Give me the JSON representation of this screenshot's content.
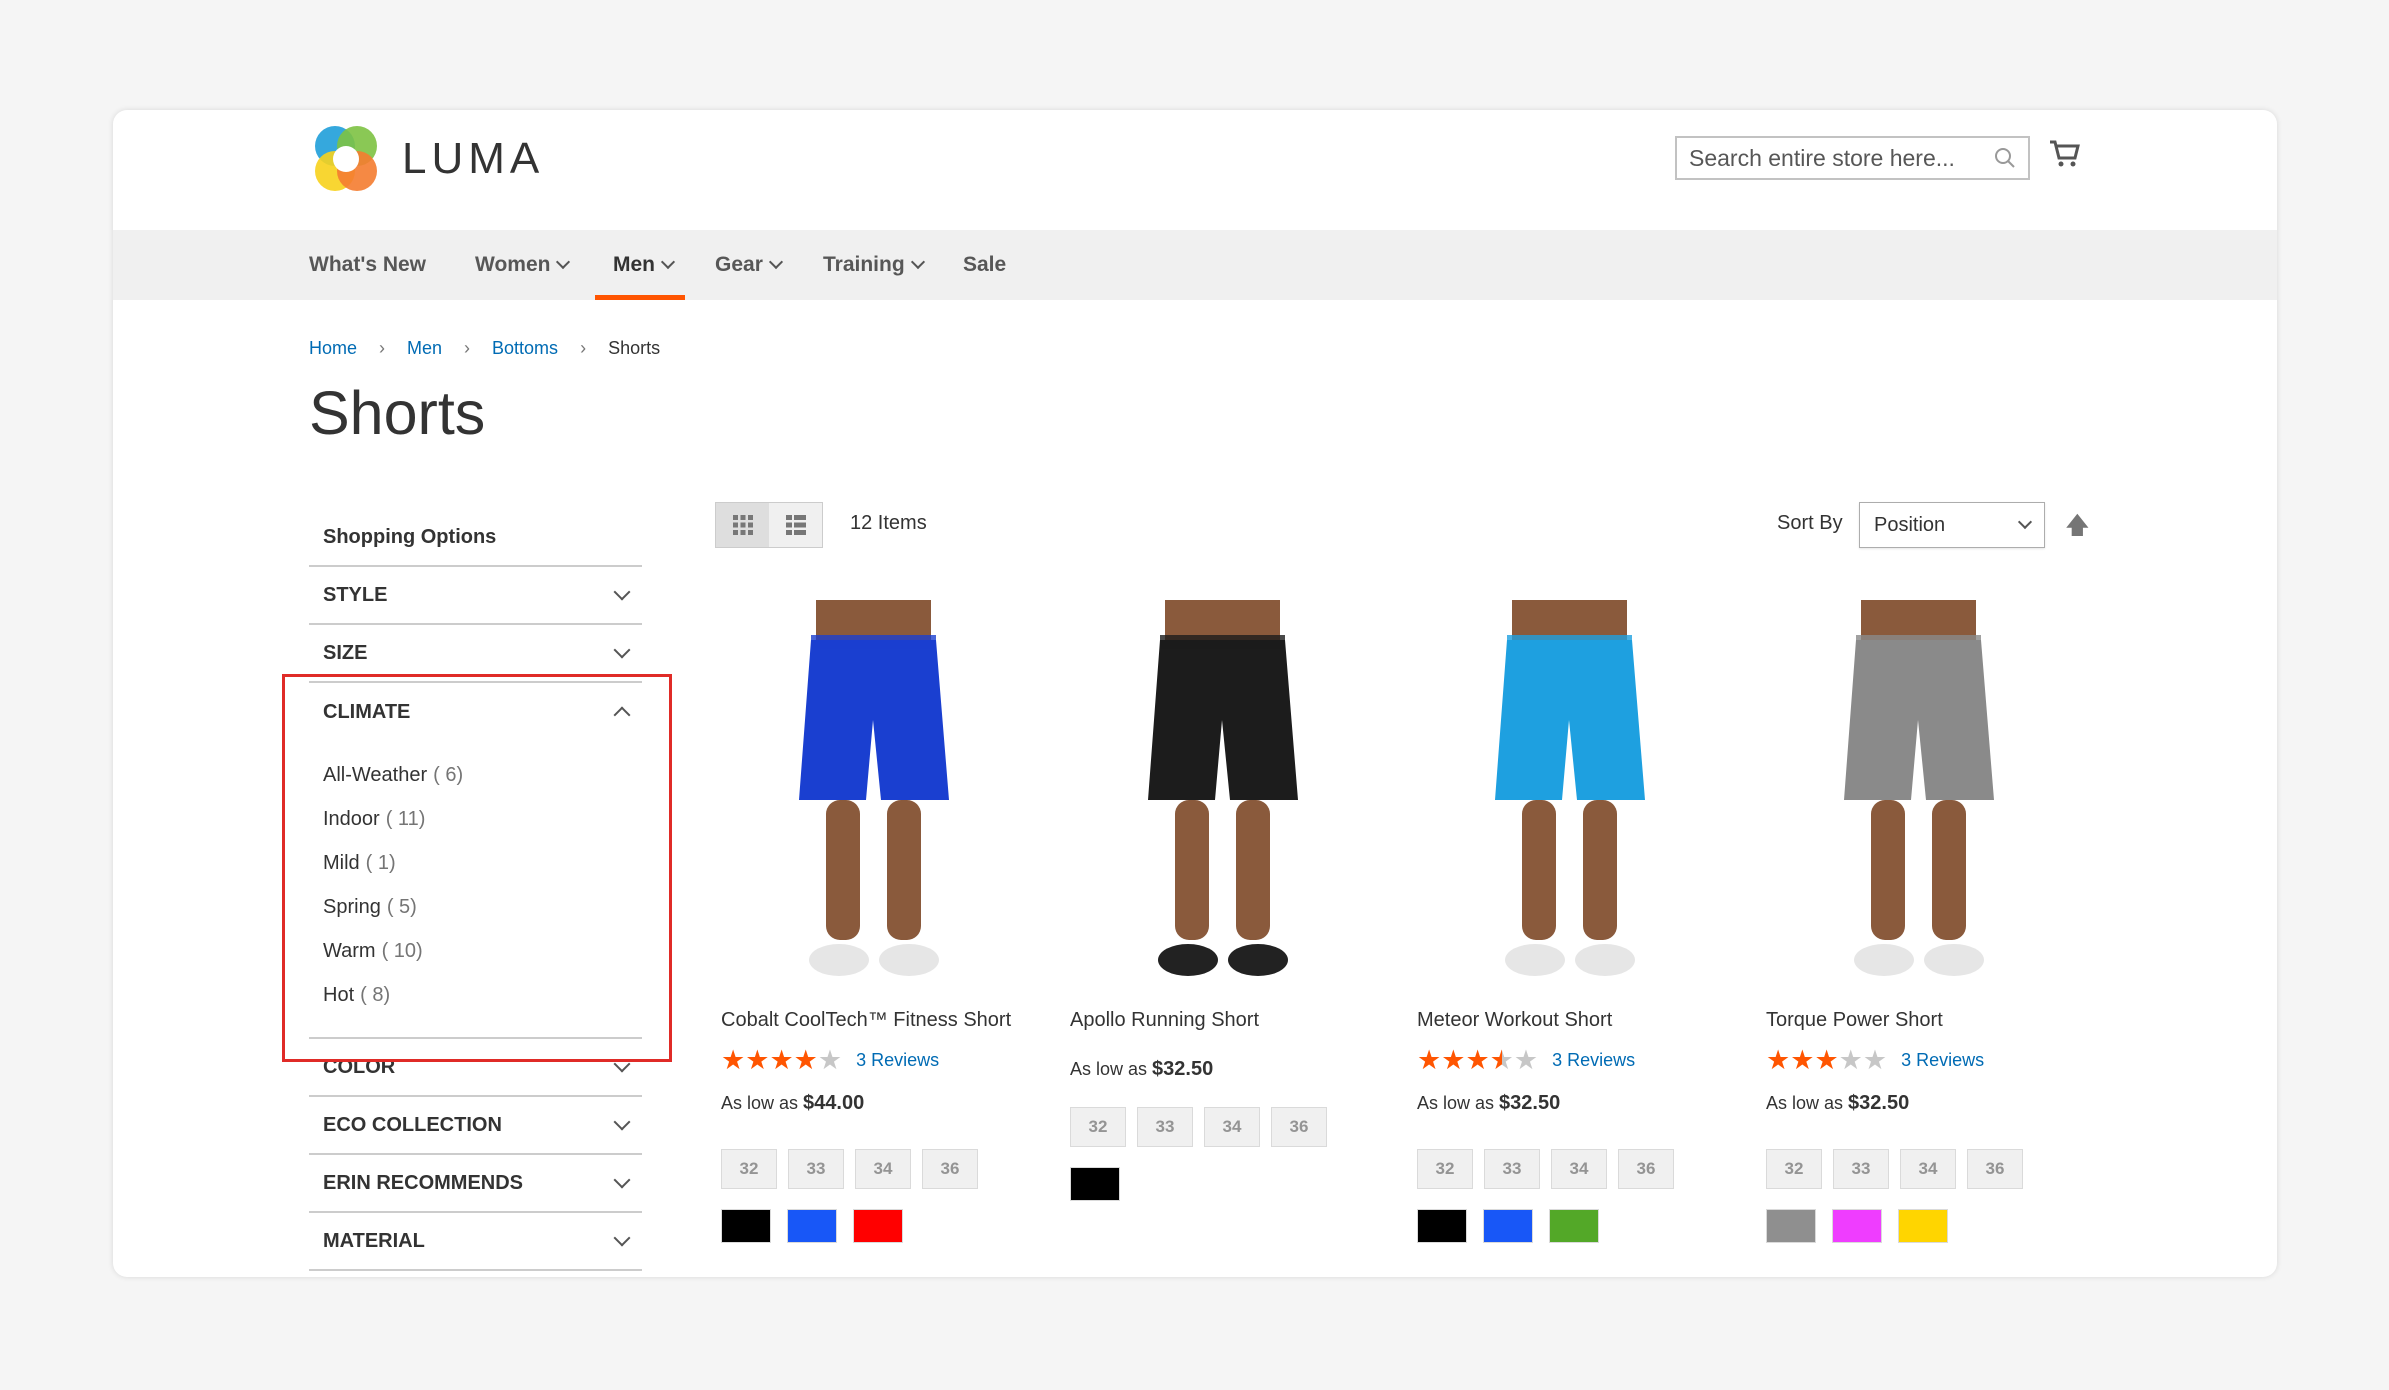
{
  "header": {
    "logo_text": "LUMA",
    "search_placeholder": "Search entire store here...",
    "colors": {
      "accent": "#ff5501",
      "link": "#006bb4"
    }
  },
  "nav": [
    "What's New",
    "Women",
    "Men",
    "Gear",
    "Training",
    "Sale"
  ],
  "breadcrumb": [
    "Home",
    "Men",
    "Bottoms",
    "Shorts"
  ],
  "page_title": "Shorts",
  "sidebar": {
    "title": "Shopping Options",
    "filters": [
      "STYLE",
      "SIZE",
      "CLIMATE",
      "COLOR",
      "ECO COLLECTION",
      "ERIN RECOMMENDS",
      "MATERIAL"
    ],
    "climate_options": [
      {
        "label": "All-Weather",
        "count": "( 6)"
      },
      {
        "label": "Indoor",
        "count": "( 11)"
      },
      {
        "label": "Mild",
        "count": "( 1)"
      },
      {
        "label": "Spring",
        "count": "( 5)"
      },
      {
        "label": "Warm",
        "count": "( 10)"
      },
      {
        "label": "Hot",
        "count": "( 8)"
      }
    ]
  },
  "toolbar": {
    "count": "12 Items",
    "sort_label": "Sort By",
    "sort_value": "Position"
  },
  "products": [
    {
      "name": "Cobalt CoolTech™ Fitness Short",
      "rating": 4,
      "reviews": "3  Reviews",
      "price_label": "As low as",
      "price": "$44.00",
      "sizes": [
        "32",
        "33",
        "34",
        "36"
      ],
      "colors": [
        "#000000",
        "#1857f7",
        "#ff0000"
      ],
      "short_color": "#1a3fd0"
    },
    {
      "name": "Apollo Running Short",
      "rating": null,
      "reviews": "",
      "price_label": "As low as",
      "price": "$32.50",
      "sizes": [
        "32",
        "33",
        "34",
        "36"
      ],
      "colors": [
        "#000000"
      ],
      "short_color": "#1c1c1c"
    },
    {
      "name": "Meteor Workout Short",
      "rating": 3.5,
      "reviews": "3  Reviews",
      "price_label": "As low as",
      "price": "$32.50",
      "sizes": [
        "32",
        "33",
        "34",
        "36"
      ],
      "colors": [
        "#000000",
        "#1857f7",
        "#53a828"
      ],
      "short_color": "#1ea0e0"
    },
    {
      "name": "Torque Power Short",
      "rating": 3,
      "reviews": "3  Reviews",
      "price_label": "As low as",
      "price": "$32.50",
      "sizes": [
        "32",
        "33",
        "34",
        "36"
      ],
      "colors": [
        "#8f8f8f",
        "#ef3dff",
        "#ffd500"
      ],
      "short_color": "#8a8a8a"
    }
  ]
}
